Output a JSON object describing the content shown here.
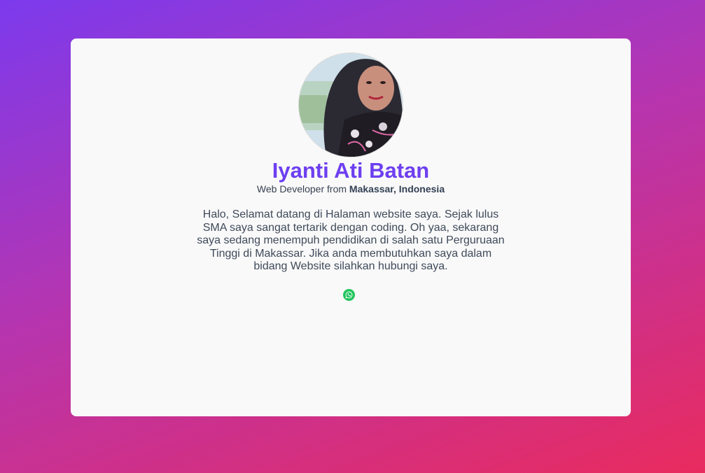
{
  "profile": {
    "name": "Iyanti Ati Batan",
    "role_prefix": "Web Developer from",
    "location": "Makassar, Indonesia",
    "bio": "Halo, Selamat datang di Halaman website saya. Sejak lulus SMA saya sangat tertarik dengan coding. Oh yaa, sekarang saya sedang menempuh pendidikan di salah satu Perguruaan Tinggi di Makassar. Jika anda membutuhkan saya dalam bidang Website silahkan hubungi saya."
  },
  "contact": {
    "whatsapp_icon": "whatsapp-icon"
  },
  "colors": {
    "name": "#6d3ff0",
    "card": "#f9f9f9",
    "whatsapp": "#22c55e",
    "background_start": "#7c3aed",
    "background_end": "#e92b5e"
  }
}
